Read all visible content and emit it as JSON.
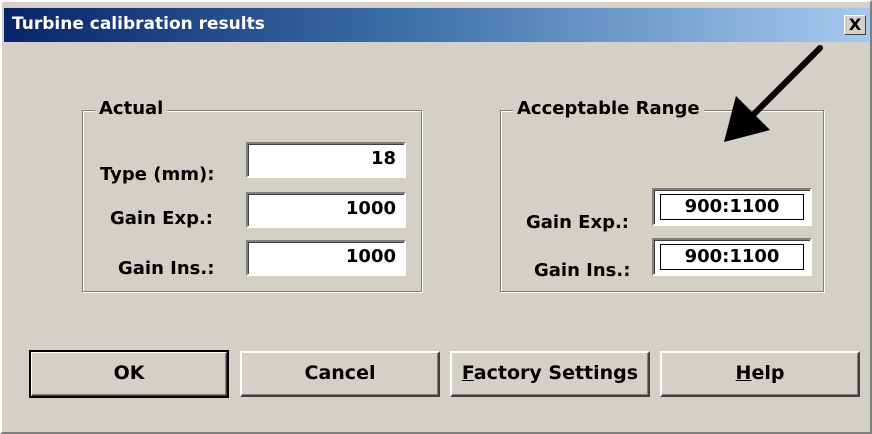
{
  "window": {
    "title": "Turbine calibration results",
    "close_label": "X"
  },
  "actual": {
    "legend": "Actual",
    "type_label": "Type (mm):",
    "type_value": "18",
    "gain_exp_label": "Gain Exp.:",
    "gain_exp_value": "1000",
    "gain_ins_label": "Gain Ins.:",
    "gain_ins_value": "1000"
  },
  "range": {
    "legend": "Acceptable Range",
    "gain_exp_label": "Gain Exp.:",
    "gain_exp_value": "900:1100",
    "gain_ins_label": "Gain Ins.:",
    "gain_ins_value": "900:1100"
  },
  "buttons": {
    "ok": "OK",
    "cancel": "Cancel",
    "factory_first": "F",
    "factory_rest": "actory Settings",
    "help_first": "H",
    "help_rest": "elp"
  },
  "annotation": {
    "icon": "arrow-icon",
    "color": "#000000"
  },
  "colors": {
    "face": "#d4d0c8",
    "title_start": "#0a246a",
    "title_end": "#a6caf0"
  }
}
